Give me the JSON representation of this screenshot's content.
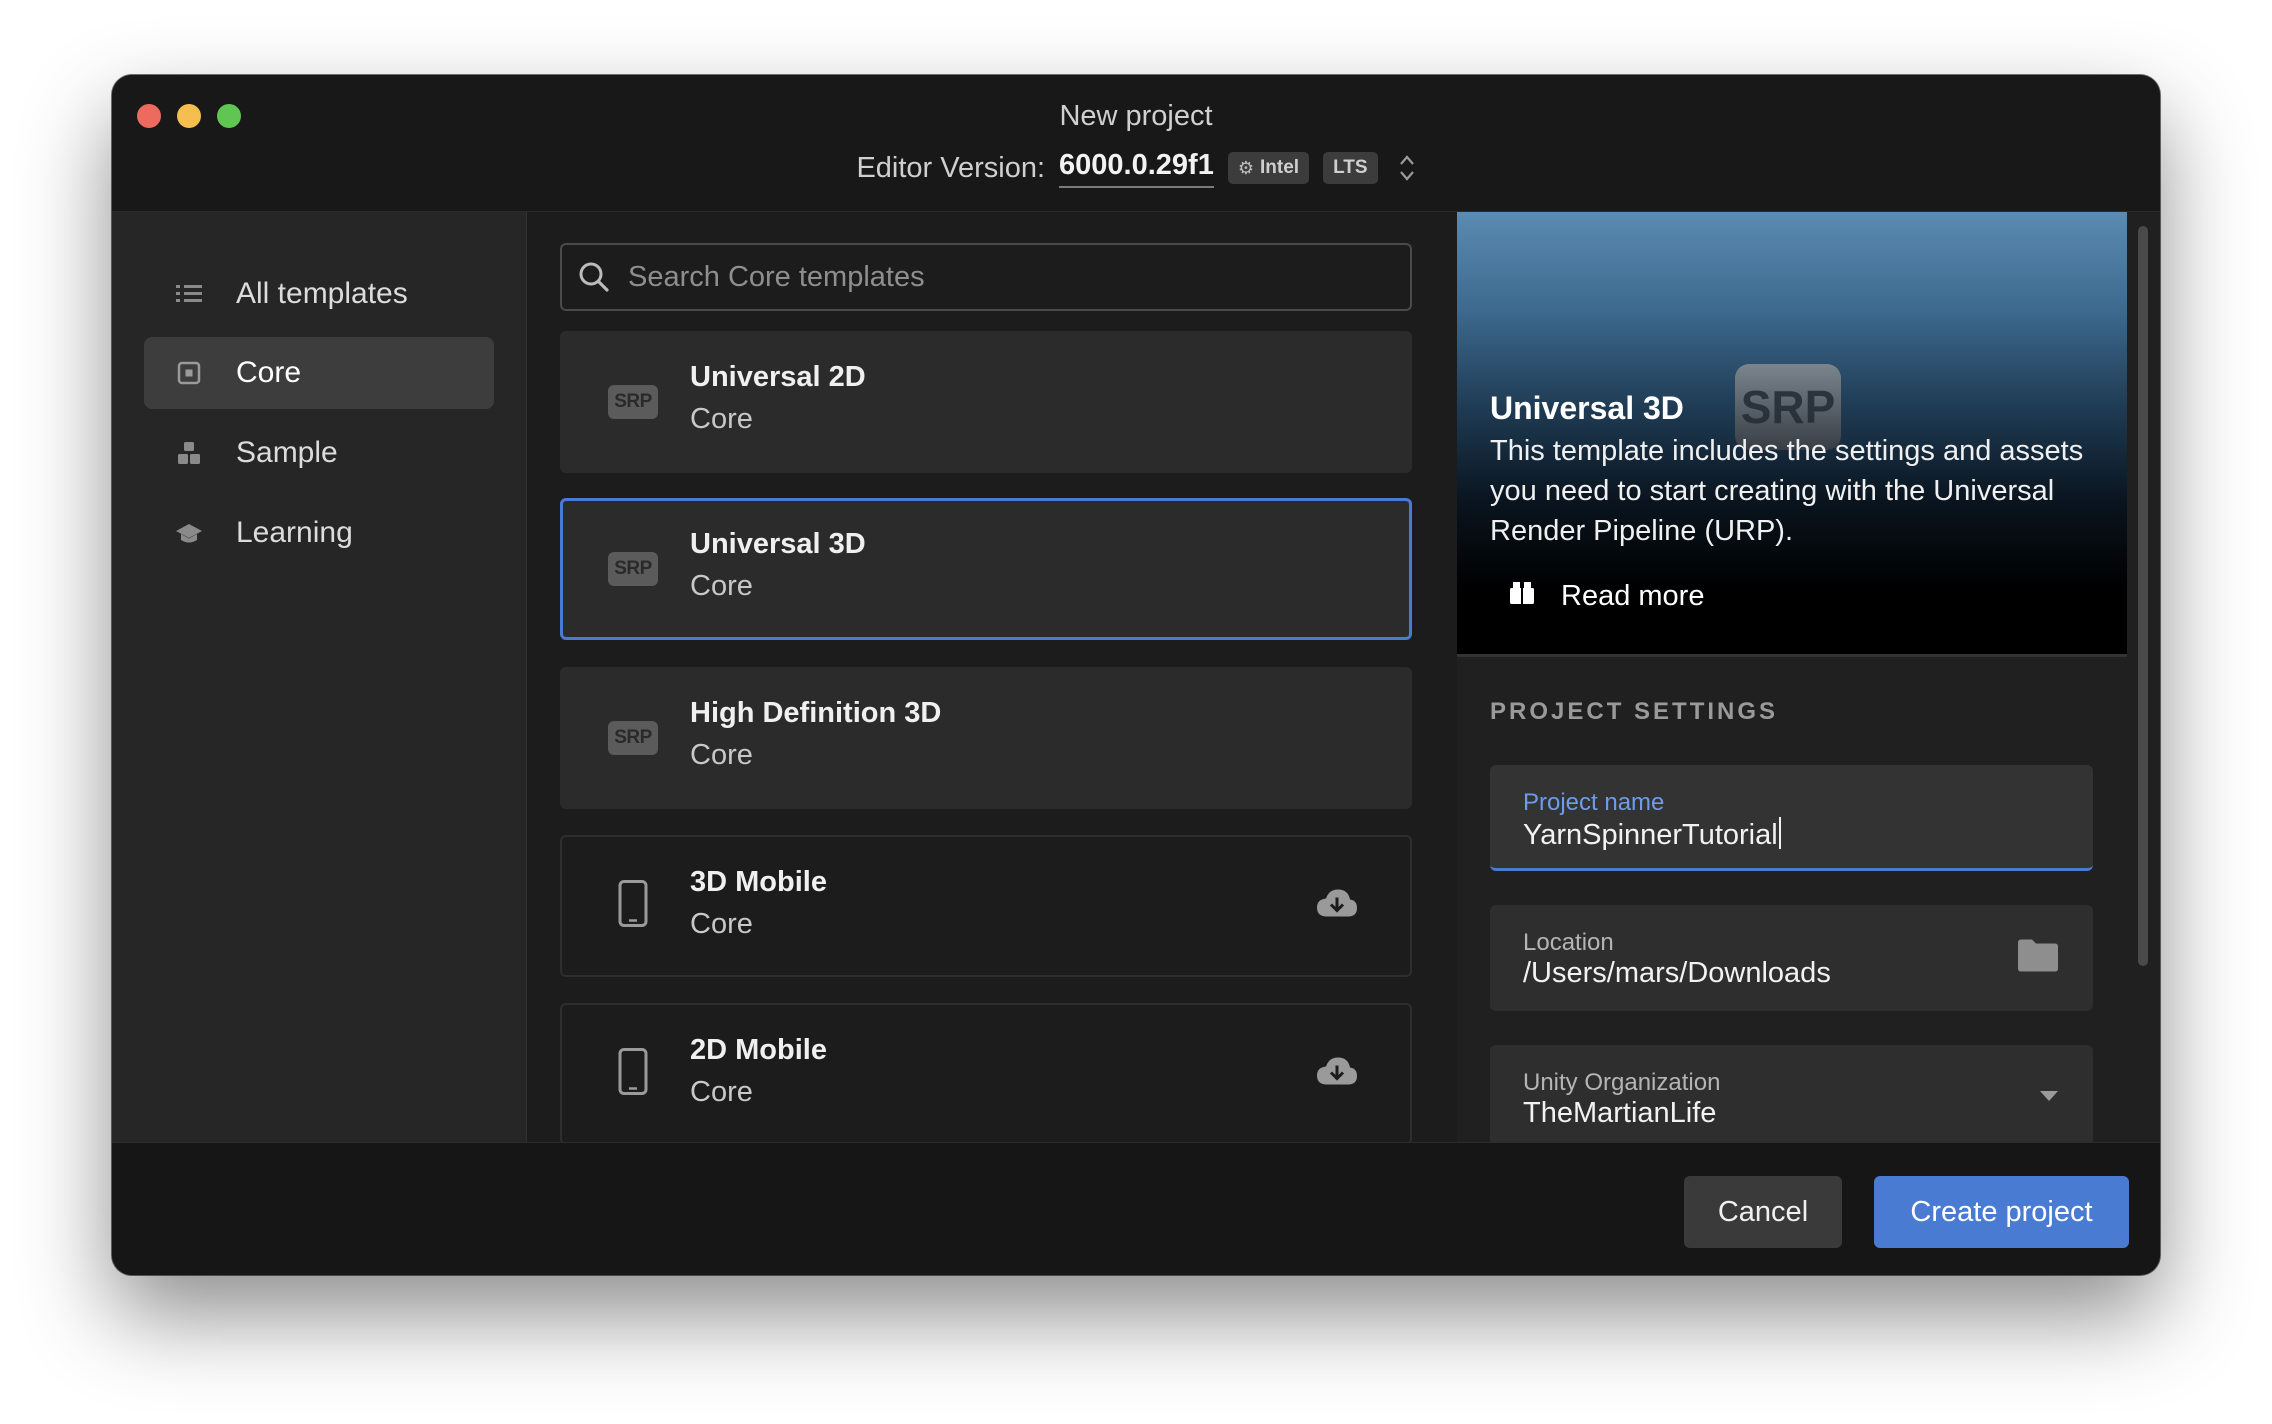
{
  "window": {
    "title": "New project",
    "editor_version_label": "Editor Version:",
    "editor_version": "6000.0.29f1",
    "arch_chip": "Intel",
    "channel_chip": "LTS"
  },
  "sidebar": {
    "items": [
      {
        "label": "All templates",
        "icon": "list-icon",
        "active": false
      },
      {
        "label": "Core",
        "icon": "core-square-icon",
        "active": true
      },
      {
        "label": "Sample",
        "icon": "blocks-icon",
        "active": false
      },
      {
        "label": "Learning",
        "icon": "graduation-cap-icon",
        "active": false
      }
    ]
  },
  "search": {
    "placeholder": "Search Core templates"
  },
  "templates": [
    {
      "title": "Universal 2D",
      "category": "Core",
      "icon_text": "SRP",
      "selected": false,
      "download": false
    },
    {
      "title": "Universal 3D",
      "category": "Core",
      "icon_text": "SRP",
      "selected": true,
      "download": false
    },
    {
      "title": "High Definition 3D",
      "category": "Core",
      "icon_text": "SRP",
      "selected": false,
      "download": false
    },
    {
      "title": "3D Mobile",
      "category": "Core",
      "icon": "phone-icon",
      "selected": false,
      "download": true
    },
    {
      "title": "2D Mobile",
      "category": "Core",
      "icon": "phone-icon",
      "selected": false,
      "download": true
    }
  ],
  "details": {
    "logo_text": "SRP",
    "title": "Universal 3D",
    "description": "This template includes the settings and assets you need to start creating with the Universal Render Pipeline (URP).",
    "read_more": "Read more"
  },
  "project_settings": {
    "section_title": "PROJECT SETTINGS",
    "name_label": "Project name",
    "name_value": "YarnSpinnerTutorial",
    "location_label": "Location",
    "location_value": "/Users/mars/Downloads",
    "org_label": "Unity Organization",
    "org_value": "TheMartianLife"
  },
  "footer": {
    "cancel_label": "Cancel",
    "create_label": "Create project"
  },
  "colors": {
    "accent": "#4a7bd3",
    "window_bg": "#1b1b1b",
    "sidebar_bg": "#262626"
  }
}
